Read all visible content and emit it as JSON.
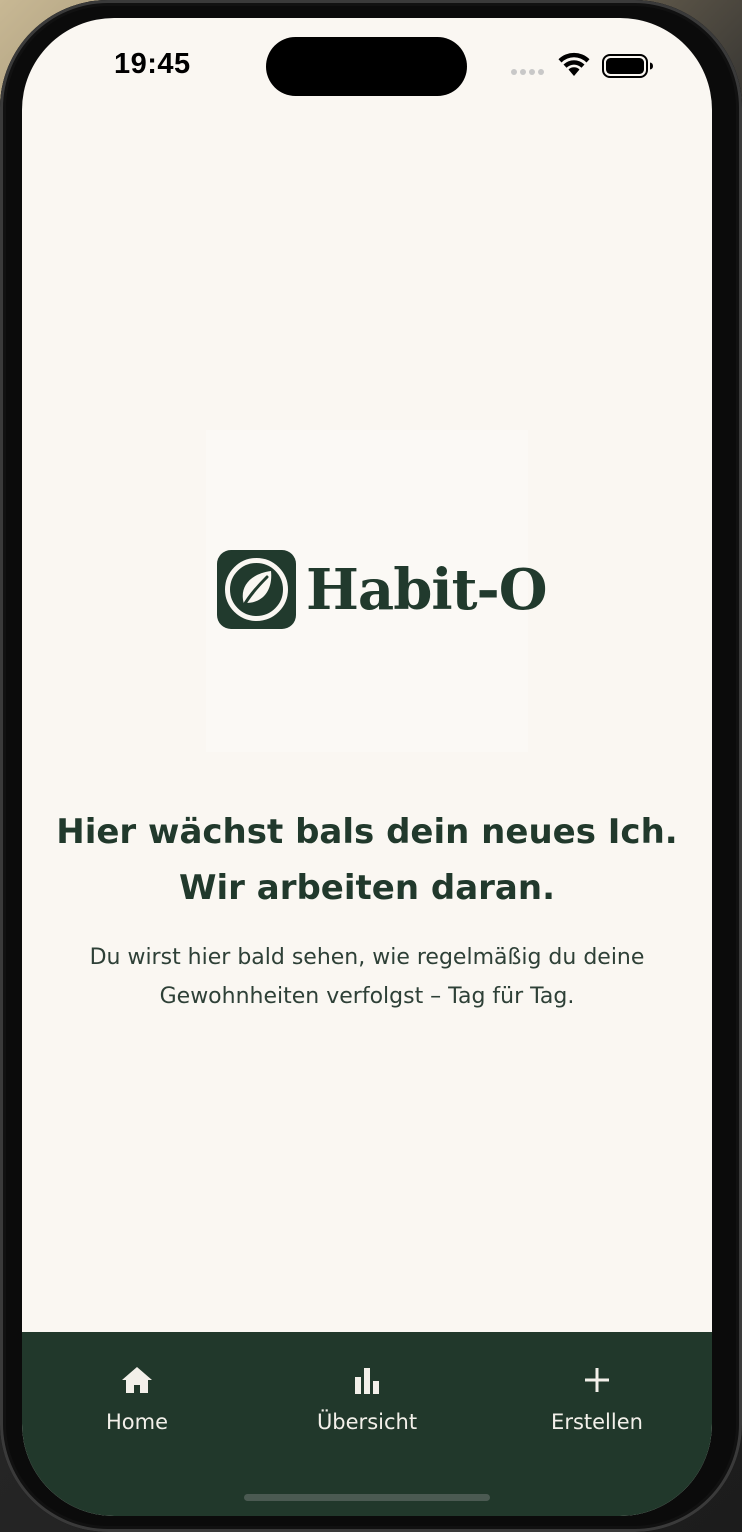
{
  "status_bar": {
    "time": "19:45",
    "icons": [
      "signal-dots-icon",
      "wifi-icon",
      "battery-icon"
    ]
  },
  "brand": {
    "name": "Habit-O",
    "icon": "leaf-icon"
  },
  "content": {
    "headline_line1": "Hier wächst bals dein neues Ich.",
    "headline_line2": "Wir arbeiten daran.",
    "subtext_line1": "Du wirst hier bald sehen, wie regelmäßig du deine",
    "subtext_line2": "Gewohnheiten verfolgst – Tag für Tag."
  },
  "tab_bar": {
    "items": [
      {
        "label": "Home",
        "icon": "home-icon"
      },
      {
        "label": "Übersicht",
        "icon": "bar-chart-icon"
      },
      {
        "label": "Erstellen",
        "icon": "plus-icon"
      }
    ]
  },
  "colors": {
    "brand_green": "#213a2d",
    "screen_background": "#faf7f2",
    "tab_bar_background": "#21382b",
    "tab_label": "#f3f0ea"
  }
}
